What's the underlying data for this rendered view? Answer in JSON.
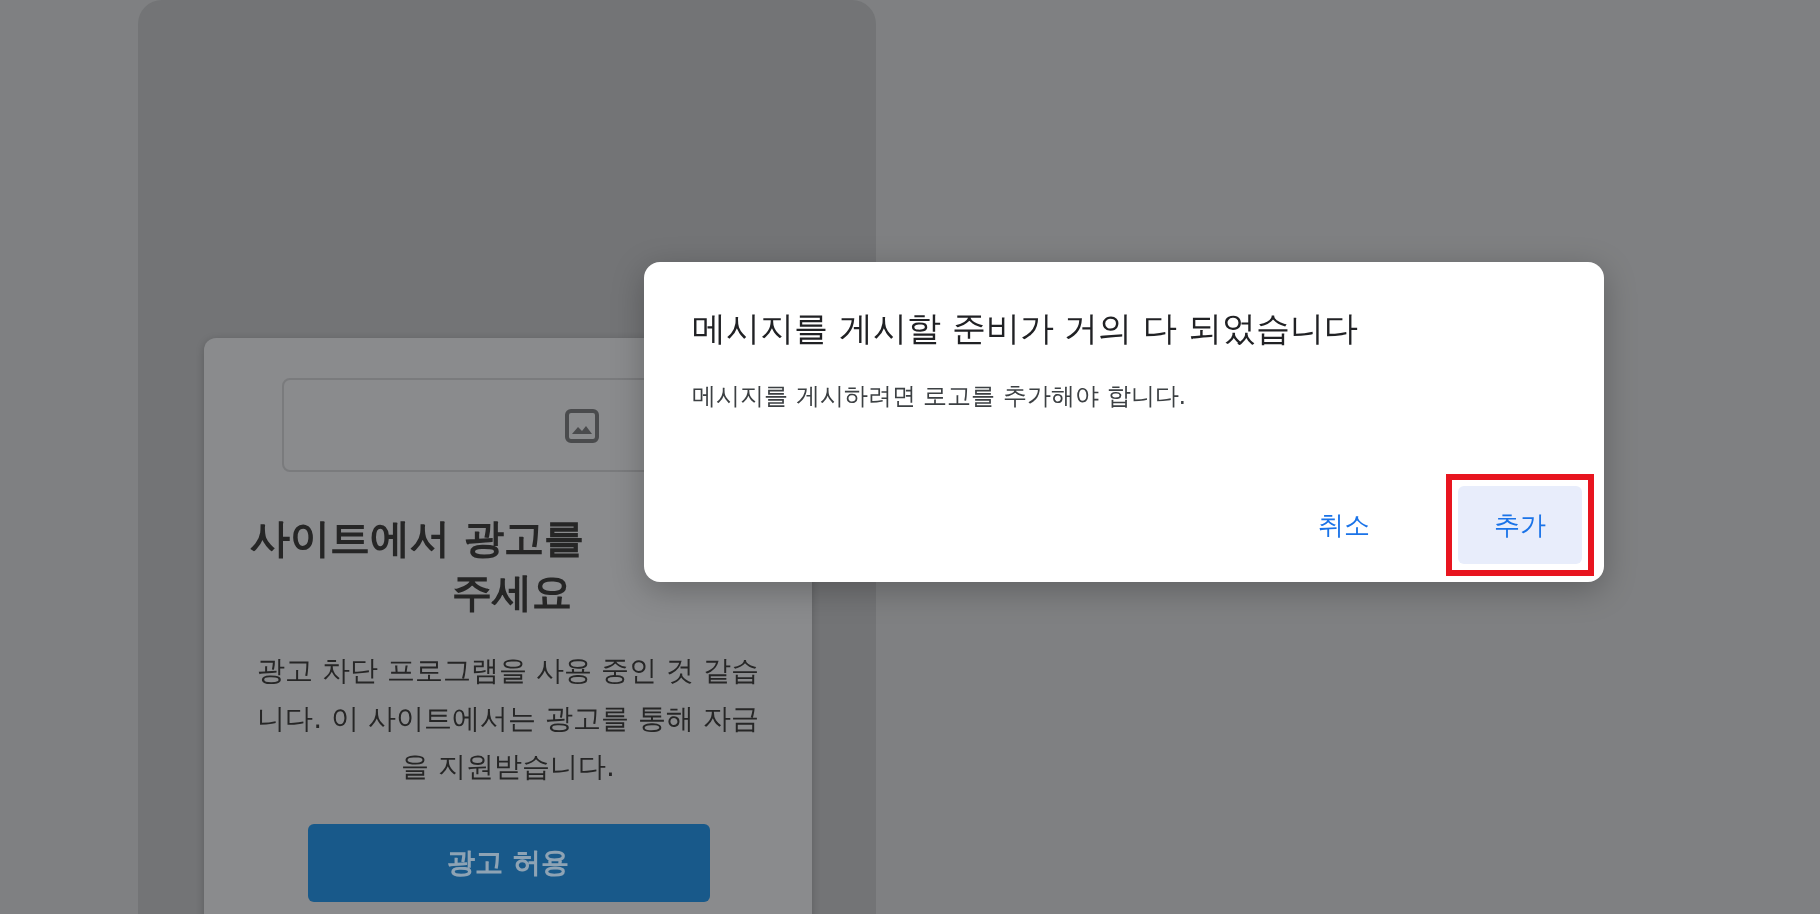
{
  "card": {
    "heading_lines": [
      "사이트에서 광고를",
      "주세요"
    ],
    "message": "광고 차단 프로그램을 사용 중인 것 같습니다. 이 사이트에서는 광고를 통해 자금을 지원받습니다.",
    "button": "광고 허용"
  },
  "dialog": {
    "title": "메시지를 게시할 준비가 거의 다 되었습니다",
    "message": "메시지를 게시하려면 로고를 추가해야 합니다.",
    "buttons": [
      {
        "label": "취소",
        "kind": "text",
        "highlighted": false
      },
      {
        "label": "추가",
        "kind": "tonal",
        "highlighted": true
      }
    ]
  }
}
